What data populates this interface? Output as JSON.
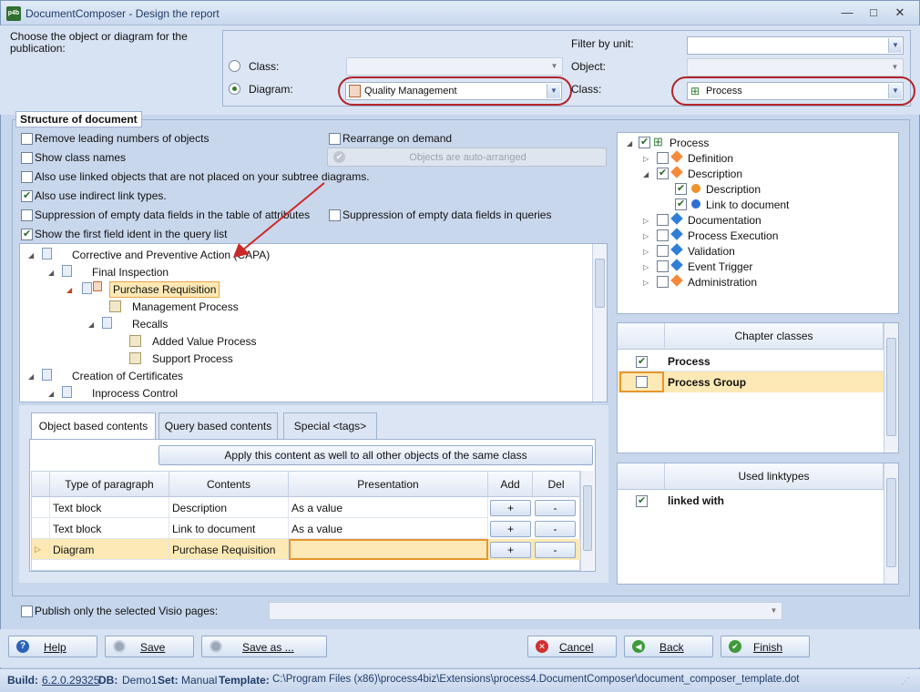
{
  "window": {
    "title": "DocumentComposer - Design the report",
    "icon": "p4b"
  },
  "top": {
    "choose_label": "Choose the object or diagram for the publication:",
    "class_label": "Class:",
    "diagram_label": "Diagram:",
    "diagram_value": "Quality Management",
    "filter_label": "Filter by unit:",
    "object_label": "Object:",
    "class2_label": "Class:",
    "class2_value": "Process"
  },
  "structure": {
    "title": "Structure of document",
    "options": [
      {
        "label": "Remove leading numbers of objects",
        "checked": false
      },
      {
        "label": "Show class names",
        "checked": false
      },
      {
        "label": "Also use linked objects that are not placed on your subtree diagrams.",
        "checked": false
      },
      {
        "label": "Also use indirect link types.",
        "checked": true
      },
      {
        "label": "Suppression of empty data fields in the table of attributes",
        "checked": false
      },
      {
        "label": "Show the first field ident in the query list",
        "checked": true
      }
    ],
    "rearrange_label": "Rearrange on demand",
    "auto_arranged": "Objects are auto-arranged",
    "suppress_queries_label": "Suppression of empty data fields in queries",
    "tree": [
      "Corrective and Preventive Action (CAPA)",
      "Final Inspection",
      "Purchase Requisition",
      "Management Process",
      "Recalls",
      "Added Value Process",
      "Support Process",
      "Creation of Certificates",
      "Inprocess Control"
    ]
  },
  "tabs": [
    "Object based contents",
    "Query based contents",
    "Special <tags>"
  ],
  "apply_button": "Apply this content as well to all other objects of the same class",
  "grid": {
    "headers": [
      "Type of paragraph",
      "Contents",
      "Presentation",
      "Add",
      "Del"
    ],
    "rows": [
      {
        "type": "Text block",
        "contents": "Description",
        "presentation": "As a value",
        "add": "+",
        "del": "-"
      },
      {
        "type": "Text block",
        "contents": "Link to document",
        "presentation": "As a value",
        "add": "+",
        "del": "-"
      },
      {
        "type": "Diagram",
        "contents": "Purchase Requisition",
        "presentation": "",
        "add": "+",
        "del": "-"
      }
    ]
  },
  "right_tree": {
    "root": "Process",
    "items": [
      "Definition",
      "Description",
      "Description",
      "Link to document",
      "Documentation",
      "Process Execution",
      "Validation",
      "Event Trigger",
      "Administration"
    ]
  },
  "chapter_classes": {
    "header": "Chapter classes",
    "rows": [
      {
        "label": "Process",
        "checked": true
      },
      {
        "label": "Process Group",
        "checked": false
      }
    ]
  },
  "used_linktypes": {
    "header": "Used linktypes",
    "rows": [
      {
        "label": "linked with",
        "checked": true
      }
    ]
  },
  "publish_label": "Publish only the selected Visio pages:",
  "buttons": {
    "help": "Help",
    "save": "Save",
    "save_as": "Save as ...",
    "cancel": "Cancel",
    "back": "Back",
    "finish": "Finish"
  },
  "status": {
    "build_label": "Build:",
    "build_value": "6.2.0.29325",
    "db_label": "DB:",
    "db_value": "Demo1",
    "set_label": "Set:",
    "set_value": "Manual",
    "template_label": "Template:",
    "template_value": "C:\\Program Files (x86)\\process4biz\\Extensions\\process4.DocumentComposer\\document_composer_template.dot"
  },
  "colors": {
    "highlight": "#fde9b5",
    "oval": "#b2252a",
    "accent": "#3d5f99"
  }
}
